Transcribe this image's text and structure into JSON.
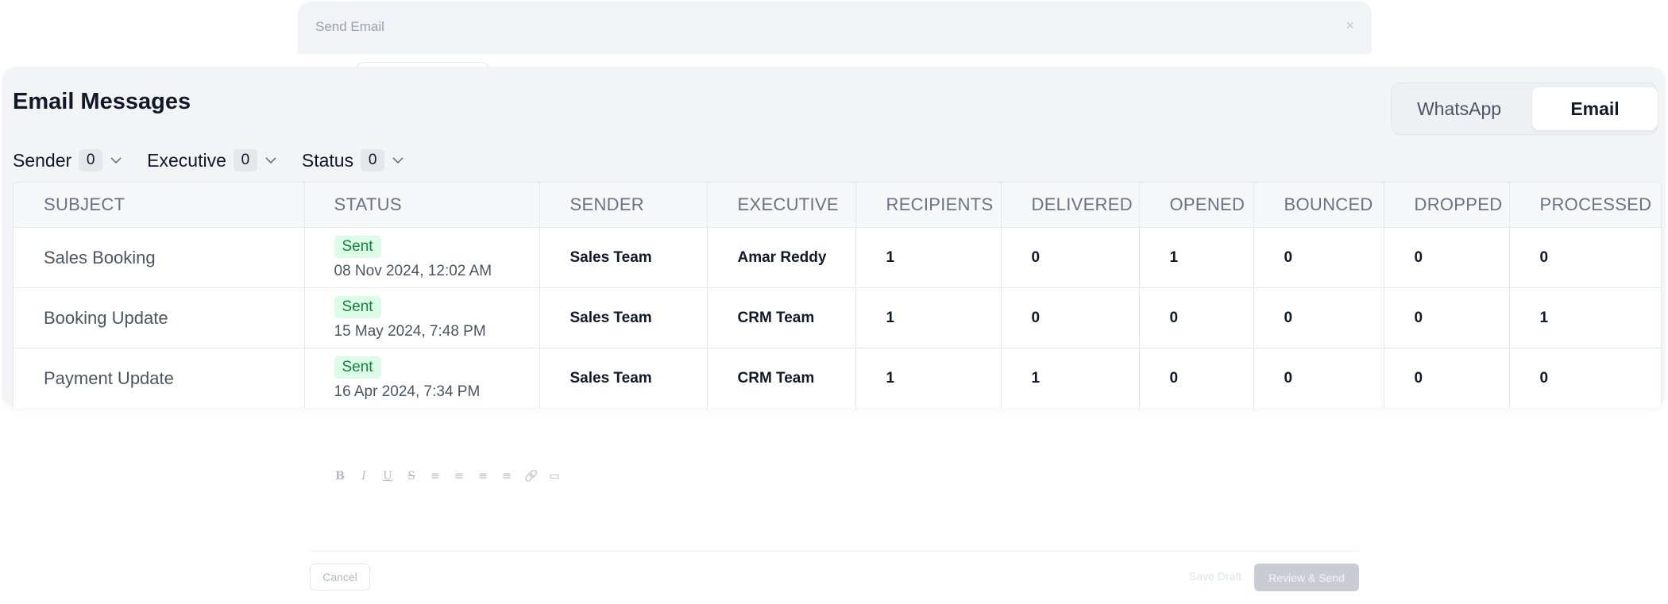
{
  "background_modal": {
    "title": "Send Email",
    "close_glyph": "×",
    "toolbar": [
      "B",
      "I",
      "U",
      "S",
      "≡",
      "≡",
      "≡",
      "≡",
      "🔗",
      "▭"
    ],
    "cancel_label": "Cancel",
    "save_draft_label": "Save Draft",
    "review_send_label": "Review & Send"
  },
  "page": {
    "title": "Email Messages",
    "channel_toggle": {
      "options": [
        "WhatsApp",
        "Email"
      ],
      "active": "Email"
    }
  },
  "filters": [
    {
      "label": "Sender",
      "count": "0",
      "icon": "chevron-down-icon"
    },
    {
      "label": "Executive",
      "count": "0",
      "icon": "chevron-down-icon"
    },
    {
      "label": "Status",
      "count": "0",
      "icon": "chevron-down-icon"
    }
  ],
  "table": {
    "columns": [
      "SUBJECT",
      "STATUS",
      "SENDER",
      "EXECUTIVE",
      "RECIPIENTS",
      "DELIVERED",
      "OPENED",
      "BOUNCED",
      "DROPPED",
      "PROCESSED"
    ],
    "rows": [
      {
        "subject": "Sales Booking",
        "status": "Sent",
        "date": "08 Nov 2024, 12:02 AM",
        "sender": "Sales Team",
        "executive": "Amar Reddy",
        "recipients": "1",
        "delivered": "0",
        "opened": "1",
        "bounced": "0",
        "dropped": "0",
        "processed": "0"
      },
      {
        "subject": "Booking Update",
        "status": "Sent",
        "date": "15 May 2024, 7:48 PM",
        "sender": "Sales Team",
        "executive": "CRM Team",
        "recipients": "1",
        "delivered": "0",
        "opened": "0",
        "bounced": "0",
        "dropped": "0",
        "processed": "1"
      },
      {
        "subject": "Payment Update",
        "status": "Sent",
        "date": "16 Apr 2024, 7:34 PM",
        "sender": "Sales Team",
        "executive": "CRM Team",
        "recipients": "1",
        "delivered": "1",
        "opened": "0",
        "bounced": "0",
        "dropped": "0",
        "processed": "0"
      }
    ]
  },
  "colors": {
    "status_sent_bg": "#dcfce7",
    "status_sent_text": "#15803d",
    "card_bg": "#f3f4f6"
  }
}
